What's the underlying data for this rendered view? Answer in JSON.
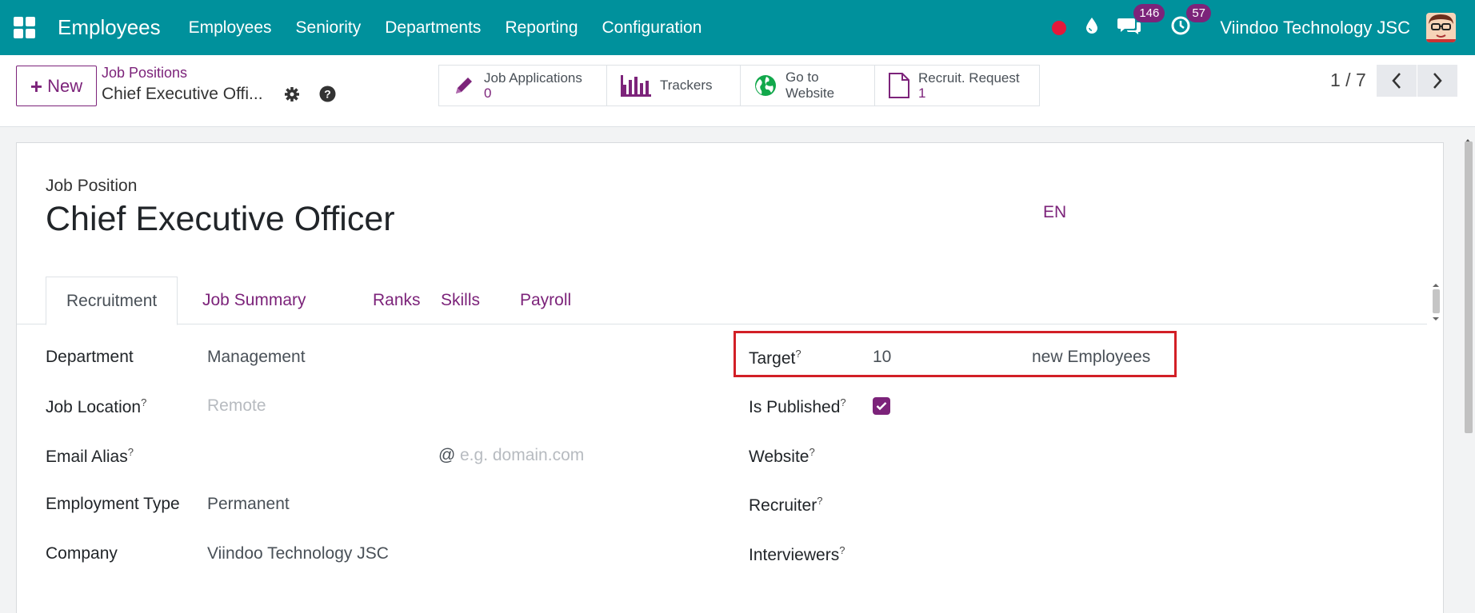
{
  "navbar": {
    "app_title": "Employees",
    "menu": [
      "Employees",
      "Seniority",
      "Departments",
      "Reporting",
      "Configuration"
    ],
    "messages_count": "146",
    "activities_count": "57",
    "company": "Viindoo Technology JSC",
    "bg_color": "#00919c"
  },
  "control": {
    "new_label": "New",
    "breadcrumb_parent": "Job Positions",
    "breadcrumb_current": "Chief Executive Offi...",
    "smart_buttons": [
      {
        "label": "Job Applications",
        "value": "0",
        "icon": "pencil-icon"
      },
      {
        "label": "Trackers",
        "icon": "bar-chart-icon"
      },
      {
        "label": "Go to",
        "label2": "Website",
        "icon": "globe-icon"
      },
      {
        "label": "Recruit. Request",
        "value": "1",
        "icon": "file-icon"
      }
    ],
    "pager": "1 / 7"
  },
  "form": {
    "label": "Job Position",
    "title": "Chief Executive Officer",
    "lang": "EN",
    "tabs": [
      "Recruitment",
      "Job Summary",
      "Ranks",
      "Skills",
      "Payroll"
    ],
    "left_fields": [
      {
        "label": "Department",
        "value": "Management"
      },
      {
        "label": "Job Location",
        "placeholder": "Remote"
      },
      {
        "label": "Email Alias",
        "at": "@",
        "placeholder": "e.g. domain.com"
      },
      {
        "label": "Employment Type",
        "value": "Permanent"
      },
      {
        "label": "Company",
        "value": "Viindoo Technology JSC"
      }
    ],
    "right_fields": [
      {
        "label": "Target",
        "value": "10",
        "suffix": "new Employees"
      },
      {
        "label": "Is Published",
        "checked": true
      },
      {
        "label": "Website"
      },
      {
        "label": "Recruiter"
      },
      {
        "label": "Interviewers"
      }
    ],
    "help_mark": "?"
  },
  "accent_color": "#7c237a"
}
